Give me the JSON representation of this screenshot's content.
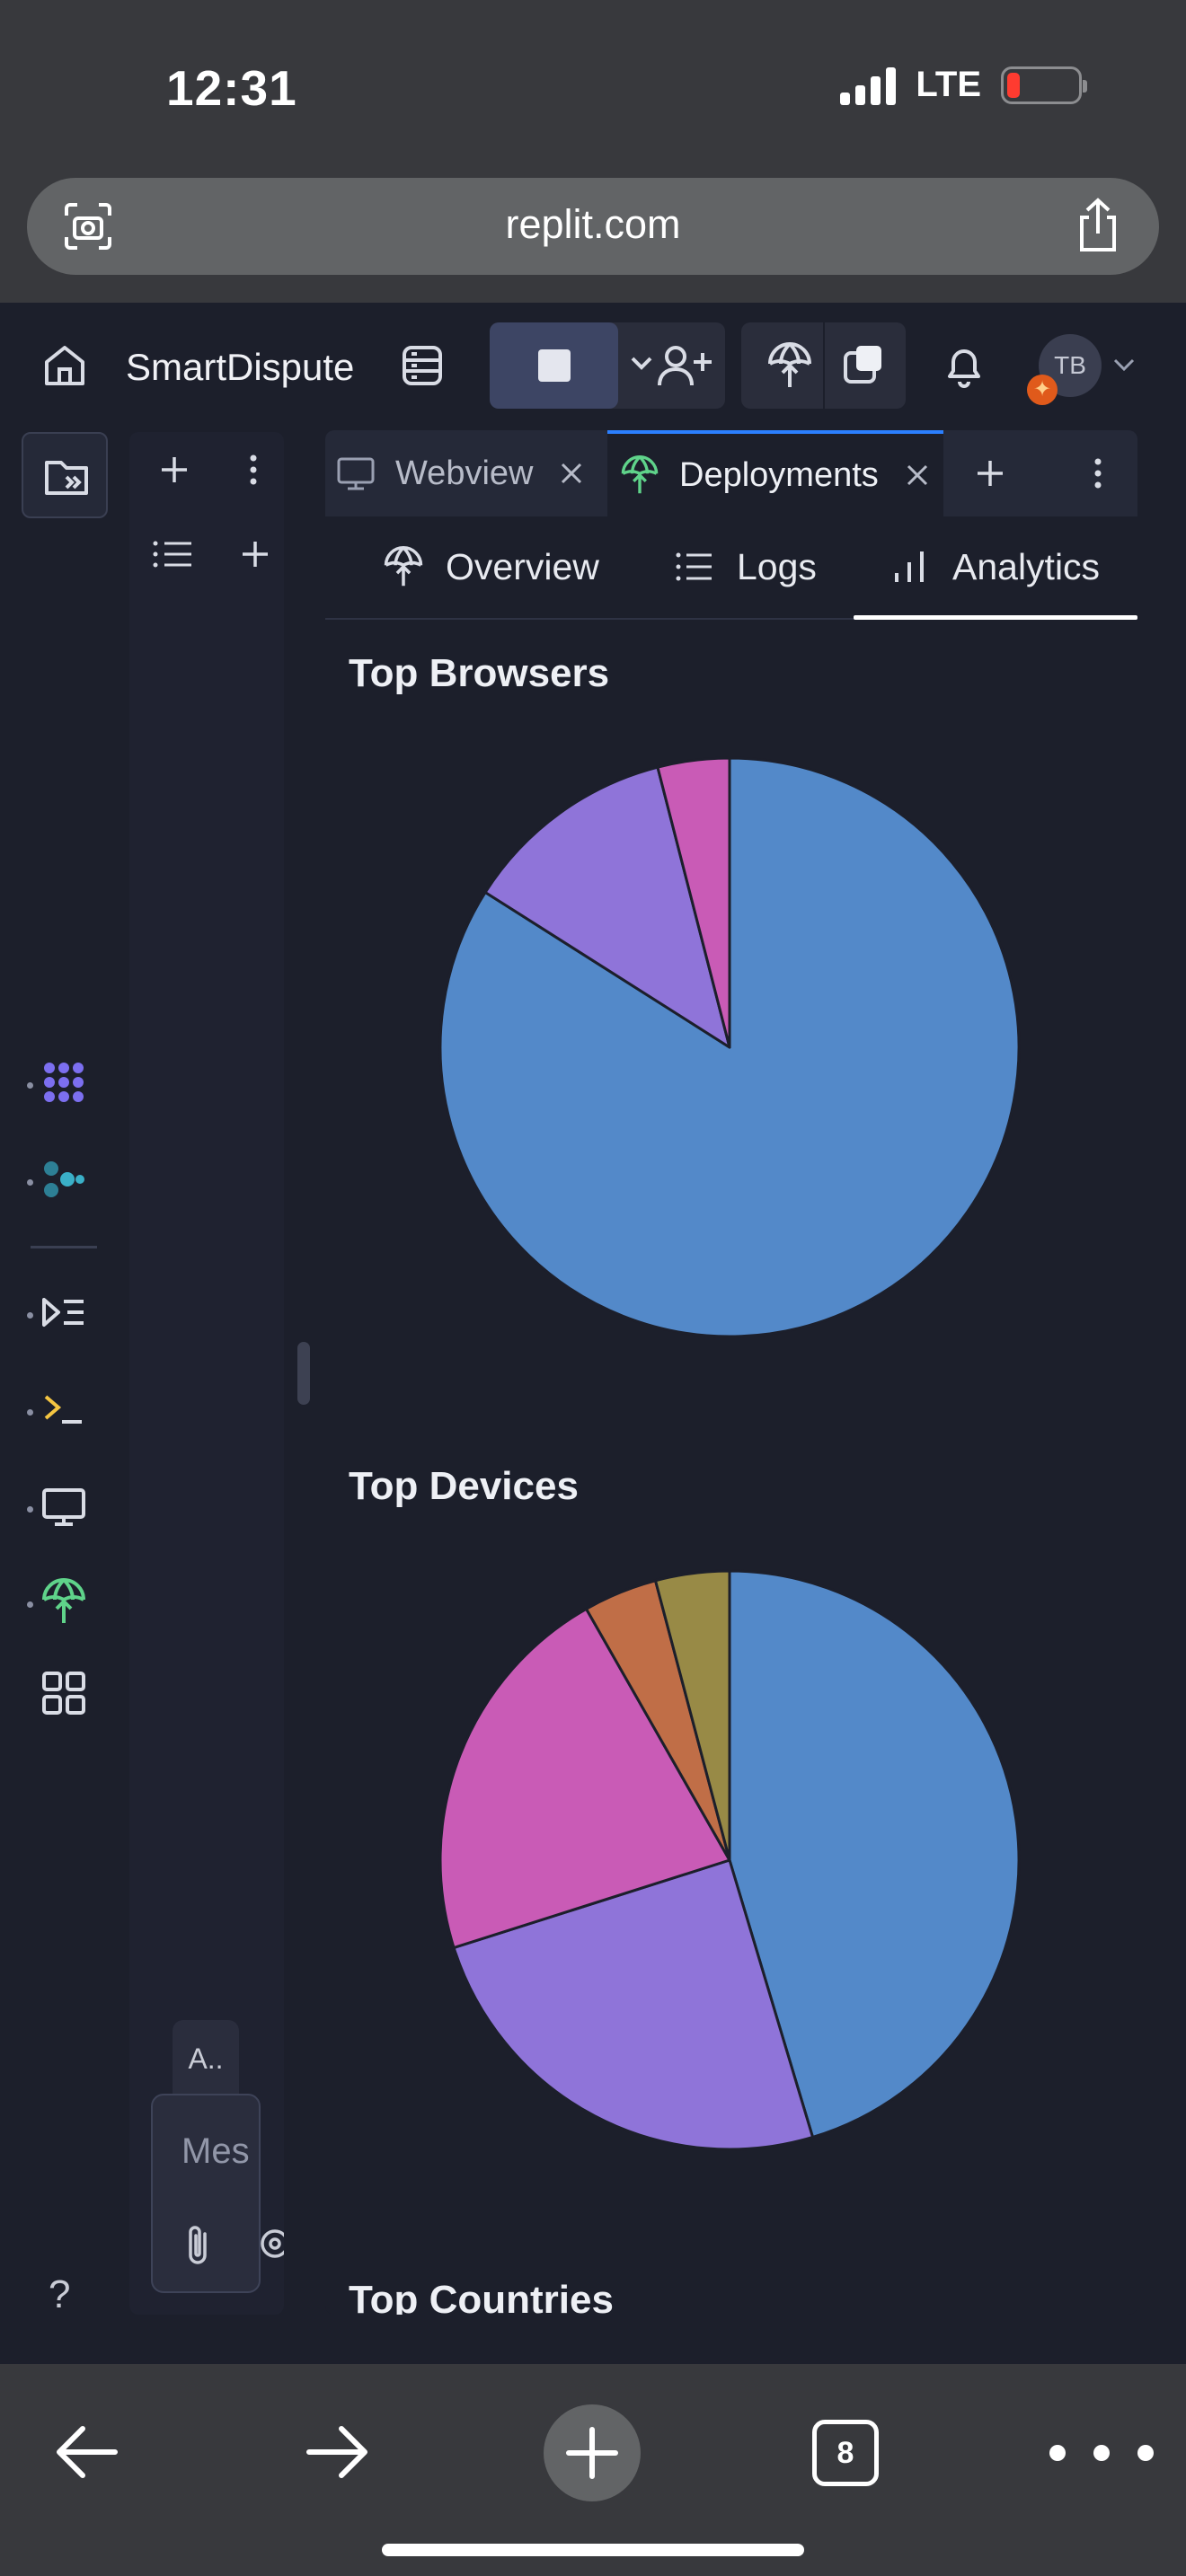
{
  "status_bar": {
    "time": "12:31",
    "network": "LTE"
  },
  "browser": {
    "url": "replit.com",
    "open_tabs": "8"
  },
  "header": {
    "app_name": "SmartDispute",
    "avatar_initials": "TB"
  },
  "chat": {
    "chip_label": "A..",
    "input_placeholder": "Mes"
  },
  "tabs": [
    {
      "label": "Webview"
    },
    {
      "label": "Deployments"
    }
  ],
  "subtabs": [
    {
      "label": "Overview"
    },
    {
      "label": "Logs"
    },
    {
      "label": "Analytics"
    }
  ],
  "rail": {
    "help": "?"
  },
  "colors": {
    "blue": "#5389c9",
    "purple": "#8f74d9",
    "magenta": "#c95bb6",
    "orange": "#c06e47",
    "olive": "#988a46",
    "accent_tab": "#2b7fff"
  },
  "chart_data": [
    {
      "type": "pie",
      "title": "Top Browsers",
      "values": [
        84,
        12,
        4
      ]
    },
    {
      "type": "pie",
      "title": "Top Devices",
      "values": [
        44,
        24,
        21,
        4,
        4
      ]
    }
  ],
  "sections": {
    "next_title": "Top Countries"
  }
}
